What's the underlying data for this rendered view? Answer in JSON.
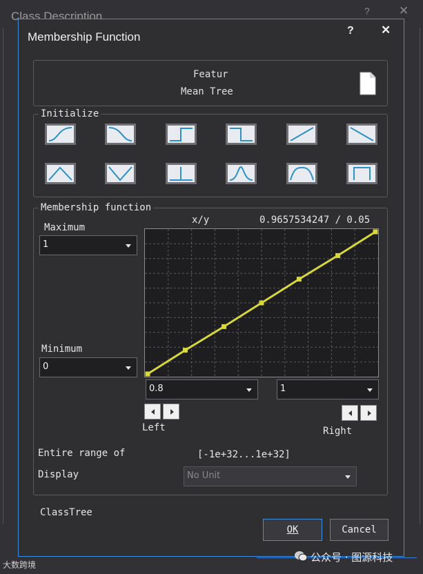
{
  "background_window": {
    "title": "Class Description",
    "help_glyph": "?",
    "close_glyph": "✕"
  },
  "dialog": {
    "title": "Membership Function",
    "help_glyph": "?",
    "close_glyph": "✕",
    "feature_line1": "Featur",
    "feature_line2": "Mean Tree",
    "initialize_legend": "Initialize",
    "shapes": [
      "larger-than-sigmoid",
      "smaller-than-sigmoid",
      "larger-than-step",
      "smaller-than-step",
      "larger-than-linear",
      "smaller-than-linear",
      "triangle",
      "inverted-triangle",
      "singleton",
      "gaussian",
      "about-range",
      "full-range"
    ],
    "mf_legend": "Membership function",
    "maximum_label": "Maximum",
    "maximum_value": "1",
    "minimum_label": "Minimum",
    "minimum_value": "0",
    "xy_label": "x/y",
    "xy_value": "0.9657534247 / 0.05",
    "left_value": "0.8",
    "right_value": "1",
    "left_label": "Left",
    "right_label": "Right",
    "entire_range_label": "Entire range of",
    "entire_range_value": "[-1e+32...1e+32]",
    "display_unit_label": "Display",
    "unit_value": "No Unit",
    "class_name": "ClassTree",
    "ok_label": "OK",
    "cancel_label": "Cancel"
  },
  "chart_data": {
    "type": "line",
    "x": [
      0.8,
      0.833,
      0.867,
      0.9,
      0.933,
      0.967,
      1.0
    ],
    "y": [
      0.0,
      0.167,
      0.333,
      0.5,
      0.667,
      0.833,
      1.0
    ],
    "xlim": [
      0.8,
      1.0
    ],
    "ylim": [
      0,
      1
    ],
    "grid": true,
    "line_color": "#d8d83a"
  },
  "watermark": {
    "left": "大数跨境",
    "right": "公众号 · 图源科技"
  },
  "colors": {
    "accent": "#3f8fe0",
    "curve": "#d8d83a",
    "shape_stroke": "#2c8fc8"
  }
}
